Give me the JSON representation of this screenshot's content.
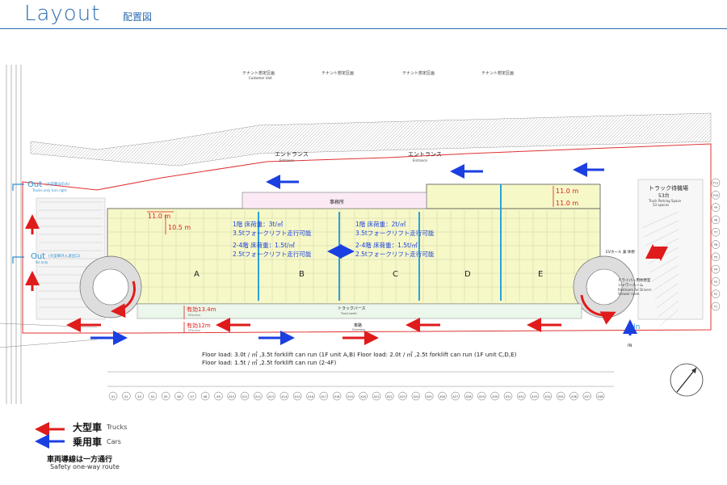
{
  "header": {
    "title": "Layout",
    "subtitle": "配置図"
  },
  "site": {
    "tenant_labels": [
      "テナント想定区画",
      "テナント想定区画",
      "テナント想定区画",
      "テナント想定区画"
    ],
    "tenant_sub": "Customer Unit",
    "entrance_left": "エントランス",
    "entrance_left_en": "Entrance",
    "entrance_right": "エントランス",
    "entrance_right_en": "Entrance",
    "office": "事務所",
    "units": [
      "A",
      "B",
      "C",
      "D",
      "E"
    ],
    "truck_wait": "トラック待機場",
    "truck_wait_count": "53台",
    "truck_wait_en1": "Truck Parking Space",
    "truck_wait_en2": "53 spaces",
    "out_label_1": "Out",
    "out_label_1_small": "(大型車はのみ)",
    "out_label_1_en": "Trucks only turn right",
    "out_label_2": "Out",
    "out_label_2_small": "(大型車外入退出口)",
    "out_label_2_en": "for only",
    "in_label": "In",
    "in_mark": "IN",
    "driver_room": "ドライバー用休憩室",
    "shower_room": "シャワールーム",
    "driver_room_en": "Restroom for Drivers",
    "shower_room_en": "Shower room",
    "ev_hall": "EVホール 兼 休憩",
    "truck_berth": "トラックバース",
    "truck_berth_en": "Truck berth",
    "drive_way": "車路",
    "drive_way_en": "Driveway",
    "dim_11_0a": "11.0 m",
    "dim_11_0b": "11.0 m",
    "dim_11_0c": "11.0 m",
    "dim_10_5": "10.5 m",
    "eff_13_4": "有効13.4m",
    "eff_13_4_en": "Effective",
    "eff_12": "有効12m",
    "eff_12_en": "Effective",
    "load_left_1": "1階 床荷重：3t/㎡",
    "load_left_2": "3.5tフォークリフト走行可能",
    "load_left_3": "2-4階 床荷重：1.5t/㎡",
    "load_left_4": "2.5tフォークリフト走行可能",
    "load_right_1": "1階 床荷重：2t/㎡",
    "load_right_2": "3.5tフォークリフト走行可能",
    "load_right_3": "2-4階 床荷重：1.5t/㎡",
    "load_right_4": "2.5tフォークリフト走行可能",
    "floor_load_1": "Floor load: 3.0t / ㎡ ,3.5t forklift can run (1F unit A,B)  Floor load: 2.0t / ㎡ ,2.5t forklift can run (1F unit C,D,E)",
    "floor_load_2": "Floor load: 1.5t / ㎡ ,2.5t forklift can run (2-4F)",
    "grid_x": [
      "X1",
      "X2",
      "X3",
      "X4",
      "X5",
      "X6",
      "X7",
      "X8",
      "X9",
      "X10",
      "X11",
      "X12",
      "X13",
      "X14",
      "X15",
      "X16",
      "X17",
      "X18",
      "X19",
      "X20",
      "X21",
      "X22",
      "X23",
      "X24",
      "X25",
      "X26",
      "X27",
      "X28",
      "X29",
      "X30",
      "X31",
      "X32",
      "X33",
      "X34",
      "X35",
      "X36",
      "X37",
      "X38"
    ],
    "grid_y": [
      "Y11",
      "Y10",
      "Y9",
      "Y8",
      "Y7",
      "Y6",
      "Y5",
      "Y4",
      "Y3",
      "Y2",
      "Y1"
    ]
  },
  "legend": {
    "trucks_jp": "大型車",
    "trucks_en": "Trucks",
    "cars_jp": "乗用車",
    "cars_en": "Cars",
    "oneway_jp": "車両導線は一方通行",
    "oneway_en": "Safety one-way route"
  },
  "colors": {
    "truck_arrow": "#e01b1b",
    "car_arrow": "#1b3fe0",
    "header": "#2b6cb0",
    "floor": "#f6f8c8",
    "column_line": "#2aa3d8",
    "boundary": "#e03030"
  }
}
